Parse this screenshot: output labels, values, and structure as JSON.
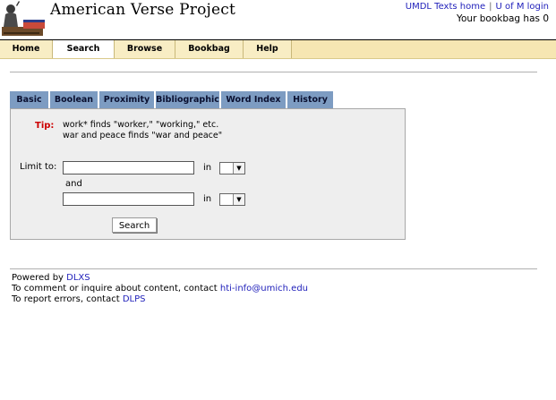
{
  "header": {
    "title": "American Verse Project",
    "links": {
      "texts_home": "UMDL Texts home",
      "login": "U of M login"
    },
    "bookbag_status": "Your bookbag has 0"
  },
  "nav": {
    "items": [
      "Home",
      "Search",
      "Browse",
      "Bookbag",
      "Help"
    ],
    "active": "Search"
  },
  "tabs": [
    "Basic",
    "Boolean",
    "Proximity",
    "Bibliographic",
    "Word Index",
    "History"
  ],
  "search_form": {
    "tip_label": "Tip:",
    "tip_lines": [
      "work* finds \"worker,\" \"working,\" etc.",
      "war and peace finds \"war and peace\""
    ],
    "limit_label": "Limit to:",
    "in_label": "in",
    "and_label": "and",
    "field1_value": "",
    "field2_value": "",
    "select1_value": "",
    "select2_value": "",
    "search_button": "Search"
  },
  "footer": {
    "powered_prefix": "Powered by ",
    "powered_link": "DLXS",
    "comment_prefix": "To comment or inquire about content, contact ",
    "comment_link": "hti-info@umich.edu",
    "errors_prefix": "To report errors, contact ",
    "errors_link": "DLPS"
  },
  "colors": {
    "nav_bg": "#f8edc4",
    "tab_bg": "#7d9cc2",
    "panel_bg": "#eeeeee",
    "tip_color": "#cc0000",
    "link_color": "#2222bb"
  }
}
